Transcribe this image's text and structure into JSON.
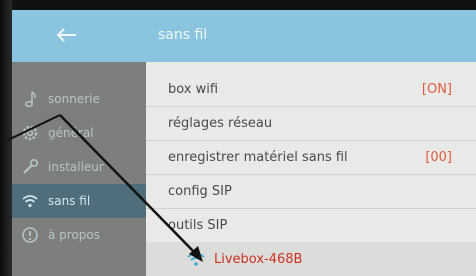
{
  "header": {
    "title": "sans fil"
  },
  "sidebar": {
    "items": [
      {
        "label": "sonnerie",
        "icon": "music-note-icon"
      },
      {
        "label": "général",
        "icon": "gear-icon"
      },
      {
        "label": "installeur",
        "icon": "wrench-icon"
      },
      {
        "label": "sans fil",
        "icon": "wifi-icon",
        "active": true
      },
      {
        "label": "à propos",
        "icon": "info-icon"
      }
    ]
  },
  "main": {
    "rows": [
      {
        "label": "box wifi",
        "value": "[ON]"
      },
      {
        "label": "réglages réseau",
        "value": ""
      },
      {
        "label": "enregistrer matériel sans fil",
        "value": "[00]"
      },
      {
        "label": "config SIP",
        "value": ""
      },
      {
        "label": "outils SIP",
        "value": ""
      }
    ],
    "network": {
      "name": "Livebox-468B",
      "icon": "wifi-icon"
    }
  },
  "colors": {
    "header": "#8bc4de",
    "sidebar": "#7d7f7e",
    "sidebar_active": "#4f6d7a",
    "value_red": "#e05a3e"
  }
}
